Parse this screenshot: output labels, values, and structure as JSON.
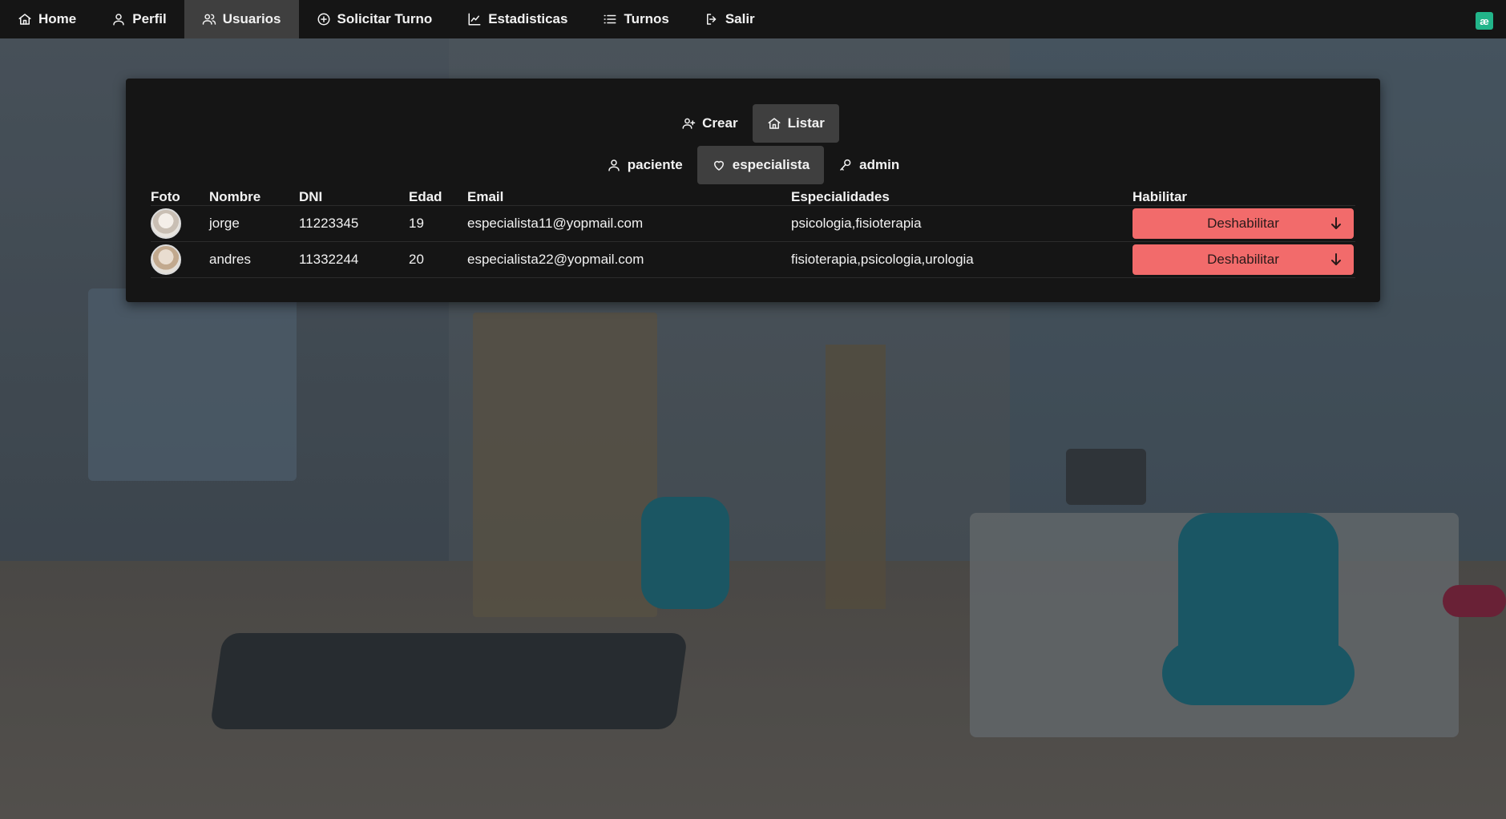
{
  "nav": {
    "items": [
      {
        "label": "Home",
        "icon": "home-icon"
      },
      {
        "label": "Perfil",
        "icon": "user-icon"
      },
      {
        "label": "Usuarios",
        "icon": "users-icon"
      },
      {
        "label": "Solicitar Turno",
        "icon": "plus-circle-icon"
      },
      {
        "label": "Estadisticas",
        "icon": "chart-line-icon"
      },
      {
        "label": "Turnos",
        "icon": "list-icon"
      },
      {
        "label": "Salir",
        "icon": "logout-icon"
      }
    ],
    "active": "Usuarios",
    "badge": "æ"
  },
  "actions": {
    "crear": "Crear",
    "listar": "Listar",
    "active": "Listar"
  },
  "roles": {
    "paciente": "paciente",
    "especialista": "especialista",
    "admin": "admin",
    "active": "especialista"
  },
  "table": {
    "headers": [
      "Foto",
      "Nombre",
      "DNI",
      "Edad",
      "Email",
      "Especialidades",
      "Habilitar"
    ],
    "rows": [
      {
        "nombre": "jorge",
        "dni": "11223345",
        "edad": "19",
        "email": "especialista11@yopmail.com",
        "especialidades": "psicologia,fisioterapia",
        "habilitar": "Deshabilitar"
      },
      {
        "nombre": "andres",
        "dni": "11332244",
        "edad": "20",
        "email": "especialista22@yopmail.com",
        "especialidades": "fisioterapia,psicologia,urologia",
        "habilitar": "Deshabilitar"
      }
    ]
  },
  "colors": {
    "navbar": "#151515",
    "active_tab": "#3f3f3f",
    "disable_button": "#f26b6b",
    "brand_badge": "#22b58a"
  }
}
